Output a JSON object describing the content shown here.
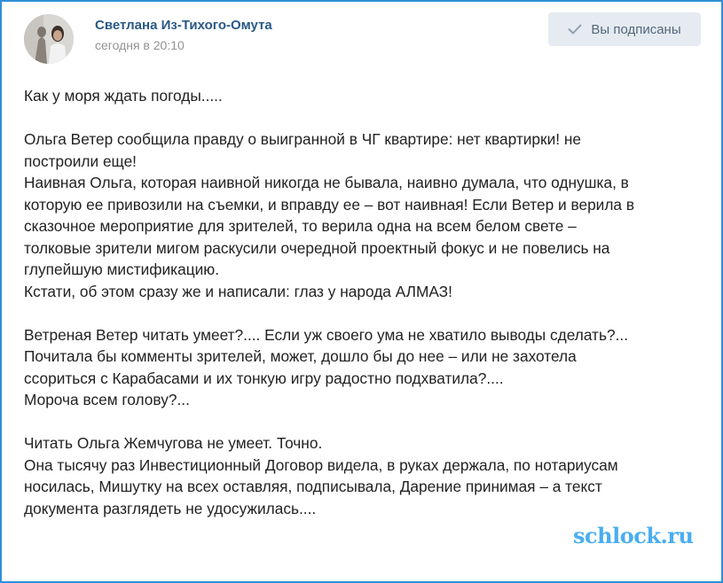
{
  "author": {
    "name": "Светлана Из-Тихого-Омута",
    "timestamp": "сегодня в 20:10"
  },
  "subscribe_button": {
    "label": "Вы подписаны",
    "icon": "check-icon"
  },
  "post": {
    "lines": [
      "Как у моря ждать погоды.....",
      "",
      "Ольга Ветер сообщила правду о выигранной в ЧГ квартире: нет квартирки! не",
      "построили еще!",
      "Наивная Ольга, которая наивной никогда не бывала, наивно думала, что однушка, в",
      "которую ее привозили на съемки, и вправду ее – вот наивная! Если Ветер и верила в",
      "сказочное мероприятие для зрителей, то верила одна на всем белом свете –",
      "толковые зрители мигом раскусили очередной проектный фокус и не повелись на",
      "глупейшую мистификацию.",
      "Кстати, об этом сразу же и написали: глаз у народа АЛМАЗ!",
      "",
      "Ветреная Ветер читать умеет?.... Если уж своего ума не хватило выводы сделать?...",
      "Почитала бы комменты зрителей, может, дошло бы до нее – или не захотела",
      "ссориться с Карабасами и их тонкую игру радостно подхватила?....",
      "Мороча всем голову?...",
      "",
      "Читать Ольга Жемчугова не умеет. Точно.",
      "Она тысячу раз Инвестиционный Договор видела, в руках держала, по нотариусам",
      "носилась, Мишутку на всех оставляя, подписывала, Дарение принимая – а текст",
      "документа разглядеть не удосужилась...."
    ]
  },
  "watermark": "schlock.ru",
  "colors": {
    "author": "#2a5885",
    "date": "#939393",
    "button_bg": "#e5ebf1",
    "button_text": "#55677d",
    "frame": "#2f8fd9"
  }
}
